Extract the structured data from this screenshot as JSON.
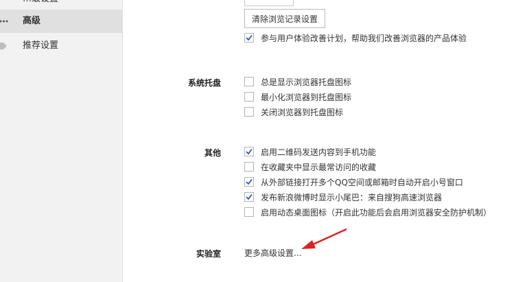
{
  "sidebar": {
    "items": [
      {
        "label": "…级设置"
      },
      {
        "label": "高级"
      },
      {
        "label": "推荐设置"
      }
    ]
  },
  "main": {
    "clear_history_button": "清除浏览记录设置",
    "ux_plan_label": "参与用户体验改善计划，帮助我们改善浏览器的产品体验",
    "ux_plan_checked": true,
    "tray": {
      "title": "系统托盘",
      "options": [
        {
          "label": "总是显示浏览器托盘图标",
          "checked": false
        },
        {
          "label": "最小化浏览器到托盘图标",
          "checked": false
        },
        {
          "label": "关闭浏览器到托盘图标",
          "checked": false
        }
      ]
    },
    "other": {
      "title": "其他",
      "options": [
        {
          "label": "启用二维码发送内容到手机功能",
          "checked": true
        },
        {
          "label": "在收藏夹中显示最常访问的收藏",
          "checked": false
        },
        {
          "label": "从外部链接打开多个QQ空间或邮箱时自动开启小号窗口",
          "checked": true
        },
        {
          "label": "发布新浪微博时显示小尾巴：来自搜狗高速浏览器",
          "checked": true
        },
        {
          "label": "启用动态桌面图标（开启此功能后会启用浏览器安全防护机制）",
          "checked": false
        }
      ]
    },
    "lab": {
      "title": "实验室",
      "more_link": "更多高级设置..."
    }
  },
  "colors": {
    "check": "#2b5ba8",
    "arrow": "#e02020",
    "sidebar_bg": "#f2f2f2",
    "active_bg": "#e0e0e0"
  }
}
